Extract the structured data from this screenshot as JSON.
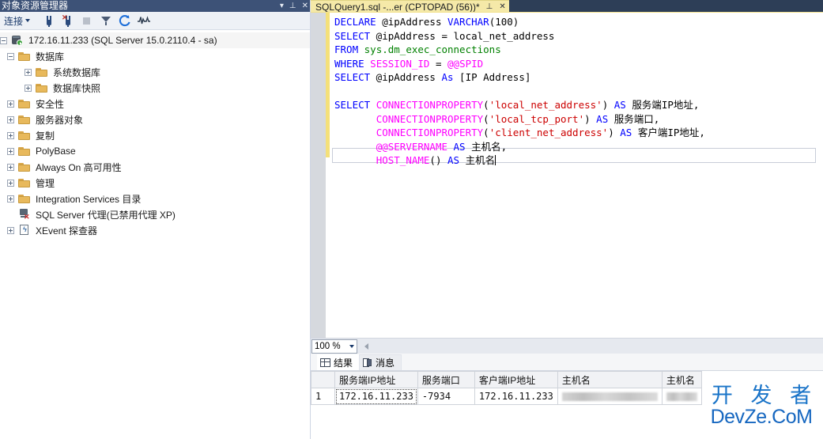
{
  "object_explorer": {
    "title": "对象资源管理器",
    "title_buttons": [
      {
        "name": "dropdown-icon",
        "glyph": "▾"
      },
      {
        "name": "pin-icon",
        "glyph": "⊥"
      },
      {
        "name": "close-icon",
        "glyph": "✕"
      }
    ],
    "toolbar": {
      "connect_label": "连接",
      "icons": [
        "connect-plug-icon",
        "disconnect-plug-icon",
        "stop-icon",
        "filter-icon",
        "refresh-icon",
        "activity-monitor-icon"
      ]
    },
    "tree": [
      {
        "label": "172.16.11.233 (SQL Server 15.0.2110.4 - sa)",
        "icon": "server-icon",
        "state": "expanded",
        "level": 0,
        "selected": true
      },
      {
        "label": "数据库",
        "icon": "folder-icon",
        "state": "expanded",
        "level": 1
      },
      {
        "label": "系统数据库",
        "icon": "folder-icon",
        "state": "collapsed",
        "level": 2
      },
      {
        "label": "数据库快照",
        "icon": "folder-icon",
        "state": "collapsed",
        "level": 2
      },
      {
        "label": "安全性",
        "icon": "folder-icon",
        "state": "collapsed",
        "level": 1
      },
      {
        "label": "服务器对象",
        "icon": "folder-icon",
        "state": "collapsed",
        "level": 1
      },
      {
        "label": "复制",
        "icon": "folder-icon",
        "state": "collapsed",
        "level": 1
      },
      {
        "label": "PolyBase",
        "icon": "folder-icon",
        "state": "collapsed",
        "level": 1
      },
      {
        "label": "Always On 高可用性",
        "icon": "folder-icon",
        "state": "collapsed",
        "level": 1
      },
      {
        "label": "管理",
        "icon": "folder-icon",
        "state": "collapsed",
        "level": 1
      },
      {
        "label": "Integration Services 目录",
        "icon": "folder-icon",
        "state": "collapsed",
        "level": 1
      },
      {
        "label": "SQL Server 代理(已禁用代理 XP)",
        "icon": "sql-agent-icon",
        "state": "leaf",
        "level": 1
      },
      {
        "label": "XEvent 探查器",
        "icon": "xevent-icon",
        "state": "collapsed",
        "level": 1
      }
    ]
  },
  "editor": {
    "tab_label": "SQLQuery1.sql -...er (CPTOPAD (56))*",
    "tab_buttons": [
      {
        "name": "pin-icon",
        "glyph": "⊥"
      },
      {
        "name": "close-icon",
        "glyph": "✕"
      }
    ],
    "code_lines": [
      [
        {
          "t": "DECLARE",
          "c": "kw"
        },
        {
          "t": " @ipAddress ",
          "c": "plain"
        },
        {
          "t": "VARCHAR",
          "c": "kw"
        },
        {
          "t": "(100)",
          "c": "plain"
        }
      ],
      [
        {
          "t": "SELECT",
          "c": "kw"
        },
        {
          "t": " @ipAddress = local_net_address",
          "c": "plain"
        }
      ],
      [
        {
          "t": "FROM",
          "c": "kw"
        },
        {
          "t": " ",
          "c": "plain"
        },
        {
          "t": "sys.dm_exec_connections",
          "c": "sch"
        }
      ],
      [
        {
          "t": "WHERE",
          "c": "kw"
        },
        {
          "t": " ",
          "c": "plain"
        },
        {
          "t": "SESSION_ID",
          "c": "fn"
        },
        {
          "t": " = ",
          "c": "plain"
        },
        {
          "t": "@@SPID",
          "c": "fn"
        }
      ],
      [
        {
          "t": "SELECT",
          "c": "kw"
        },
        {
          "t": " @ipAddress ",
          "c": "plain"
        },
        {
          "t": "As",
          "c": "kw"
        },
        {
          "t": " [IP Address]",
          "c": "plain"
        }
      ],
      [],
      [
        {
          "t": "SELECT ",
          "c": "kw"
        },
        {
          "t": "CONNECTIONPROPERTY",
          "c": "fn"
        },
        {
          "t": "(",
          "c": "plain"
        },
        {
          "t": "'local_net_address'",
          "c": "str"
        },
        {
          "t": ") ",
          "c": "plain"
        },
        {
          "t": "AS",
          "c": "kw"
        },
        {
          "t": " 服务端IP地址,",
          "c": "plain"
        }
      ],
      [
        {
          "t": "       ",
          "c": "plain"
        },
        {
          "t": "CONNECTIONPROPERTY",
          "c": "fn"
        },
        {
          "t": "(",
          "c": "plain"
        },
        {
          "t": "'local_tcp_port'",
          "c": "str"
        },
        {
          "t": ") ",
          "c": "plain"
        },
        {
          "t": "AS",
          "c": "kw"
        },
        {
          "t": " 服务端口,",
          "c": "plain"
        }
      ],
      [
        {
          "t": "       ",
          "c": "plain"
        },
        {
          "t": "CONNECTIONPROPERTY",
          "c": "fn"
        },
        {
          "t": "(",
          "c": "plain"
        },
        {
          "t": "'client_net_address'",
          "c": "str"
        },
        {
          "t": ") ",
          "c": "plain"
        },
        {
          "t": "AS",
          "c": "kw"
        },
        {
          "t": " 客户端IP地址,",
          "c": "plain"
        }
      ],
      [
        {
          "t": "       ",
          "c": "plain"
        },
        {
          "t": "@@SERVERNAME",
          "c": "fn"
        },
        {
          "t": " ",
          "c": "plain"
        },
        {
          "t": "AS",
          "c": "kw"
        },
        {
          "t": " 主机名,",
          "c": "plain"
        }
      ],
      [
        {
          "t": "       ",
          "c": "plain"
        },
        {
          "t": "HOST_NAME",
          "c": "fn"
        },
        {
          "t": "() ",
          "c": "plain"
        },
        {
          "t": "AS",
          "c": "kw"
        },
        {
          "t": " 主机名",
          "c": "plain"
        }
      ]
    ],
    "zoom_level": "100 %"
  },
  "results": {
    "tabs": [
      {
        "label": "结果",
        "icon": "grid-icon",
        "active": true
      },
      {
        "label": "消息",
        "icon": "message-icon",
        "active": false
      }
    ],
    "columns": [
      "",
      "服务端IP地址",
      "服务端口",
      "客户端IP地址",
      "主机名",
      "主机名"
    ],
    "rows": [
      {
        "num": "1",
        "cells": [
          "172.16.11.233",
          "-7934",
          "172.16.11.233",
          "__REDACTED__",
          "__REDACTED__"
        ]
      }
    ]
  },
  "watermark": {
    "line1": "开 发 者",
    "line2": "DevZe.CoM"
  },
  "colors": {
    "titlebar": "#3d5277",
    "tab_active": "#f5e9a8",
    "tabstrip_bg": "#2d3e57",
    "keyword": "#0000ff",
    "function": "#ff00ff",
    "schema": "#008000",
    "string": "#cc0000",
    "watermark": "#1a74c8"
  }
}
